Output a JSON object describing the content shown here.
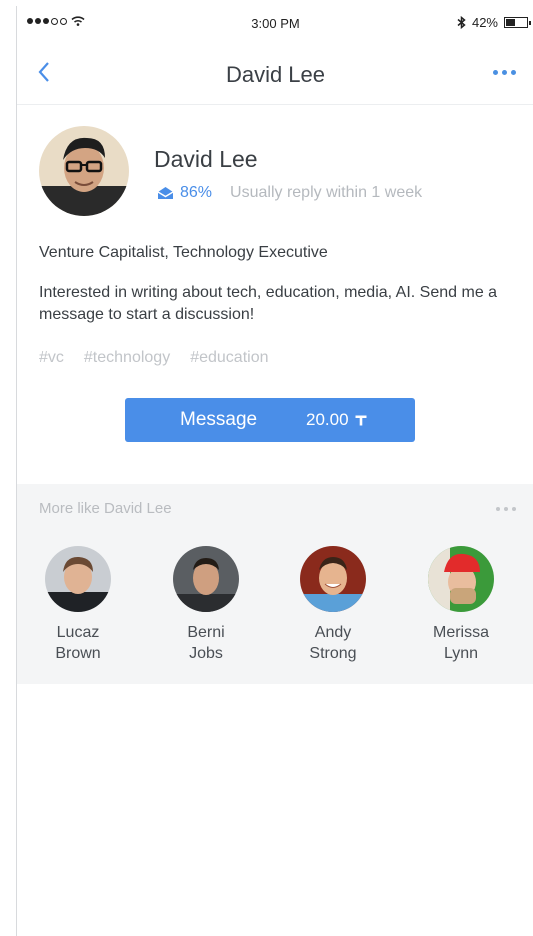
{
  "status_bar": {
    "time": "3:00 PM",
    "battery": "42%"
  },
  "nav": {
    "title": "David Lee"
  },
  "profile": {
    "name": "David Lee",
    "reply_rate": "86%",
    "reply_note": "Usually reply within 1 week",
    "headline": "Venture Capitalist, Technology Executive",
    "bio": "Interested in writing about tech, education, media, AI. Send me a message to start a discussion!",
    "tags": [
      "#vc",
      "#technology",
      "#education"
    ]
  },
  "message_button": {
    "label": "Message",
    "price": "20.00"
  },
  "similar": {
    "heading": "More like David Lee",
    "people": [
      {
        "first": "Lucaz",
        "last": "Brown"
      },
      {
        "first": "Berni",
        "last": "Jobs"
      },
      {
        "first": "Andy",
        "last": "Strong"
      },
      {
        "first": "Merissa",
        "last": "Lynn"
      }
    ]
  },
  "colors": {
    "accent": "#4a8ee8",
    "section_bg": "#f4f5f6",
    "muted_text": "#b5b9be"
  }
}
